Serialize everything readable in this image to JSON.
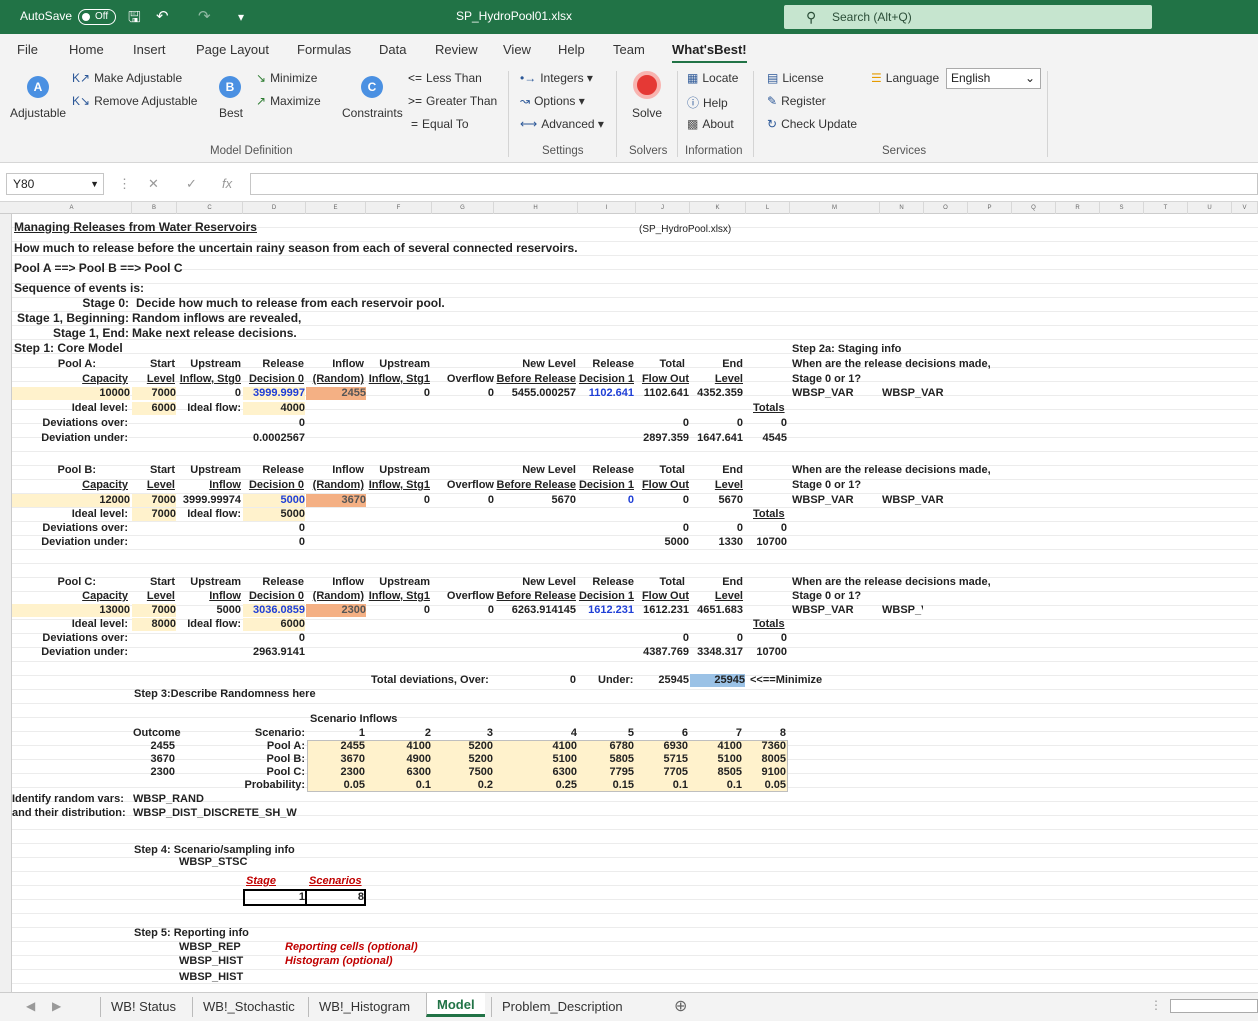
{
  "titlebar": {
    "autosave": "AutoSave",
    "toggle": "Off",
    "filename": "SP_HydroPool01.xlsx",
    "search": "Search (Alt+Q)"
  },
  "menu": [
    "File",
    "Home",
    "Insert",
    "Page Layout",
    "Formulas",
    "Data",
    "Review",
    "View",
    "Help",
    "Team",
    "What'sBest!"
  ],
  "ribbon": {
    "adjustable": "Adjustable",
    "make_adjustable": "Make Adjustable",
    "remove_adjustable": "Remove Adjustable",
    "best": "Best",
    "minimize": "Minimize",
    "maximize": "Maximize",
    "constraints": "Constraints",
    "less_than": "Less Than",
    "greater_than": "Greater Than",
    "equal_to": "Equal To",
    "integers": "Integers",
    "options": "Options",
    "advanced": "Advanced",
    "solve": "Solve",
    "locate": "Locate",
    "help": "Help",
    "about": "About",
    "license": "License",
    "register": "Register",
    "check_update": "Check Update",
    "language": "Language",
    "language_value": "English",
    "groups": {
      "model_definition": "Model Definition",
      "settings": "Settings",
      "solvers": "Solvers",
      "information": "Information",
      "services": "Services"
    }
  },
  "formula": {
    "namebox": "Y80"
  },
  "sheet": {
    "title": "Managing Releases from Water Reservoirs",
    "file_note": "(SP_HydroPool.xlsx)",
    "line2": "How much to release before the uncertain rainy season from each of several connected reservoirs.",
    "line3": "Pool A ==> Pool B ==> Pool C",
    "line4": "Sequence of events is:",
    "stage0_l": "Stage 0:",
    "stage0_r": "Decide how much to release from each reservoir pool.",
    "stage1b_l": "Stage 1, Beginning:",
    "stage1b_r": "Random inflows are revealed,",
    "stage1e_l": "Stage 1, End:",
    "stage1e_r": "Make next release decisions.",
    "step1": "Step 1: Core Model",
    "step2a": "Step 2a: Staging info",
    "when": "When are the release decisions made,",
    "stage01": "Stage 0 or 1?",
    "wbsp_var": "WBSP_VAR",
    "pool_a": "Pool A:",
    "pool_b": "Pool B:",
    "pool_c": "Pool C:",
    "h": {
      "start": "Start",
      "level": "Level",
      "upstream": "Upstream",
      "inflow_stg0": "Inflow, Stg0",
      "inflow": "Inflow",
      "release": "Release",
      "decision0": "Decision 0",
      "inflow_hdr": "Inflow",
      "random": "(Random)",
      "upstream2": "Upstream",
      "inflow_stg1": "Inflow, Stg1",
      "overflow": "Overflow",
      "new_level": "New Level",
      "before_release": "Before Release",
      "release1": "Release",
      "decision1": "Decision 1",
      "total": "Total",
      "flow_out": "Flow Out",
      "end": "End",
      "end_level": "Level",
      "capacity": "Capacity",
      "ideal_level": "Ideal level:",
      "ideal_flow": "Ideal flow:",
      "dev_over": "Deviations over:",
      "dev_under": "Deviation under:",
      "totals": "Totals"
    },
    "a": {
      "cap": "10000",
      "start": "7000",
      "up": "0",
      "rel0": "3999.9997",
      "inflow": "2455",
      "up1": "0",
      "over": "0",
      "newlvl": "5455.000257",
      "rel1": "1102.641",
      "total": "1102.641",
      "end": "4352.359",
      "ideal_level": "6000",
      "ideal_flow": "4000",
      "dov": "0",
      "dun": "0.0002567",
      "dov_k": "0",
      "dov_l": "0",
      "dov_t": "0",
      "dun_k": "2897.359",
      "dun_l": "1647.641",
      "dun_t": "4545"
    },
    "b": {
      "cap": "12000",
      "start": "7000",
      "up": "3999.99974",
      "rel0": "5000",
      "inflow": "3670",
      "up1": "0",
      "over": "0",
      "newlvl": "5670",
      "rel1": "0",
      "total": "0",
      "end": "5670",
      "ideal_level": "7000",
      "ideal_flow": "5000",
      "dov": "0",
      "dun": "0",
      "dov_k": "0",
      "dov_l": "0",
      "dov_t": "0",
      "dun_k": "5000",
      "dun_l": "1330",
      "dun_t": "10700"
    },
    "c": {
      "cap": "13000",
      "start": "7000",
      "up": "5000",
      "rel0": "3036.0859",
      "inflow": "2300",
      "up1": "0",
      "over": "0",
      "newlvl": "6263.914145",
      "rel1": "1612.231",
      "total": "1612.231",
      "end": "4651.683",
      "ideal_level": "8000",
      "ideal_flow": "6000",
      "dov": "0",
      "dun": "2963.9141",
      "dov_k": "0",
      "dov_l": "0",
      "dov_t": "0",
      "dun_k": "4387.769",
      "dun_l": "3348.317",
      "dun_t": "10700"
    },
    "totdev": "Total deviations, Over:",
    "totdev_over": "0",
    "under": "Under:",
    "under_val": "25945",
    "obj": "25945",
    "minimize_note": "<<==Minimize",
    "step3": "Step 3:Describe  Randomness here",
    "scen_inflows": "Scenario Inflows",
    "outcome": "Outcome",
    "outcomes": [
      "2455",
      "3670",
      "2300"
    ],
    "scenario": "Scenario:",
    "scen_labels": [
      "Pool A:",
      "Pool B:",
      "Pool C:",
      "Probability:"
    ],
    "scen_nums": [
      "1",
      "2",
      "3",
      "4",
      "5",
      "6",
      "7",
      "8"
    ],
    "scen_rows": [
      [
        "2455",
        "4100",
        "5200",
        "4100",
        "6780",
        "6930",
        "4100",
        "7360"
      ],
      [
        "3670",
        "4900",
        "5200",
        "5100",
        "5805",
        "5715",
        "5100",
        "8005"
      ],
      [
        "2300",
        "6300",
        "7500",
        "6300",
        "7795",
        "7705",
        "8505",
        "9100"
      ],
      [
        "0.05",
        "0.1",
        "0.2",
        "0.25",
        "0.15",
        "0.1",
        "0.1",
        "0.05"
      ]
    ],
    "ident": "Identify random vars:",
    "ident_v": "WBSP_RAND",
    "dist": "and their distribution:",
    "dist_v": "WBSP_DIST_DISCRETE_SH_W",
    "step4": "Step 4: Scenario/sampling info",
    "stsc": "WBSP_STSC",
    "stage_lbl": "Stage",
    "scen_lbl": "Scenarios",
    "stage_v": "1",
    "scen_v": "8",
    "step5": "Step 5: Reporting info",
    "rep": "WBSP_REP",
    "rep_note": "Reporting cells (optional)",
    "hist": "WBSP_HIST",
    "hist_note": "Histogram (optional)",
    "hist2": "WBSP_HIST"
  },
  "tabs": [
    "WB! Status",
    "WB!_Stochastic",
    "WB!_Histogram",
    "Model",
    "Problem_Description"
  ]
}
